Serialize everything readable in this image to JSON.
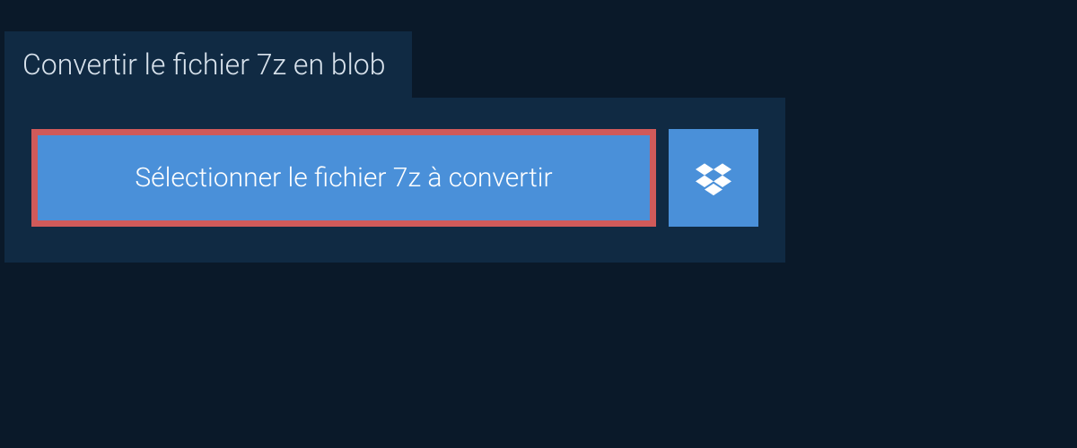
{
  "tab": {
    "title": "Convertir le fichier 7z en blob"
  },
  "upload": {
    "select_button_label": "Sélectionner le fichier 7z à convertir"
  }
}
